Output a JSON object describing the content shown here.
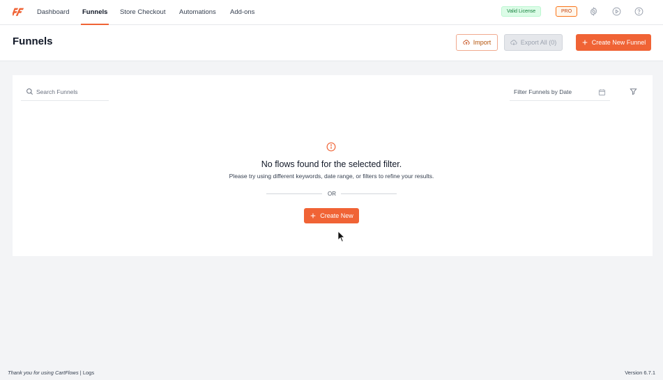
{
  "brand": {
    "logo_icon": "cartflows-logo-icon",
    "accent_color": "#f06335"
  },
  "nav": {
    "items": [
      {
        "label": "Dashboard",
        "active": false
      },
      {
        "label": "Funnels",
        "active": true
      },
      {
        "label": "Store Checkout",
        "active": false
      },
      {
        "label": "Automations",
        "active": false
      },
      {
        "label": "Add-ons",
        "active": false
      }
    ],
    "license_badge": "Valid License",
    "pro_badge": "PRO",
    "icons": [
      "gear-icon",
      "play-circle-icon",
      "help-circle-icon"
    ]
  },
  "header": {
    "title": "Funnels",
    "import_label": "Import",
    "export_label": "Export All (0)",
    "create_funnel_label": "Create New Funnel"
  },
  "filters": {
    "search_placeholder": "Search Funnels",
    "date_label": "Filter Funnels by Date"
  },
  "empty_state": {
    "title": "No flows found for the selected filter.",
    "subtitle": "Please try using different keywords, date range, or filters to refine your results.",
    "or_text": "OR",
    "create_label": "Create New"
  },
  "footer": {
    "thanks": "Thank you for using CartFlows",
    "separator": " | ",
    "logs": "Logs",
    "version": "Version 6.7.1"
  }
}
